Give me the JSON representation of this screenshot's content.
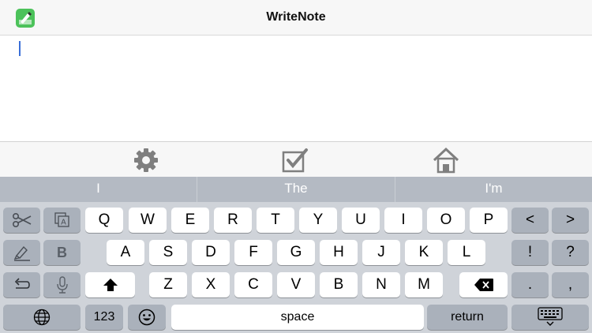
{
  "header": {
    "title": "WriteNote",
    "app_icon": "pen-note-icon"
  },
  "editor": {
    "content": ""
  },
  "toolbar": {
    "items": [
      "gear-icon",
      "checkbox-icon",
      "home-icon"
    ]
  },
  "suggestions": [
    "I",
    "The",
    "I'm"
  ],
  "keyboard": {
    "row1": [
      "Q",
      "W",
      "E",
      "R",
      "T",
      "Y",
      "U",
      "I",
      "O",
      "P"
    ],
    "row2": [
      "A",
      "S",
      "D",
      "F",
      "G",
      "H",
      "J",
      "K",
      "L"
    ],
    "row3": [
      "Z",
      "X",
      "C",
      "V",
      "B",
      "N",
      "M"
    ],
    "bold_label": "B",
    "numbers_label": "123",
    "space_label": "space",
    "return_label": "return",
    "period_label": ".",
    "comma_label": ",",
    "exclaim_label": "!",
    "question_label": "?",
    "left_arrow_label": "<",
    "right_arrow_label": ">"
  },
  "colors": {
    "accent": "#3a6fd8",
    "icon_green": "#4cc25a",
    "keyboard_bg": "#cfd3d9",
    "suggest_bg": "#b4bac3"
  }
}
